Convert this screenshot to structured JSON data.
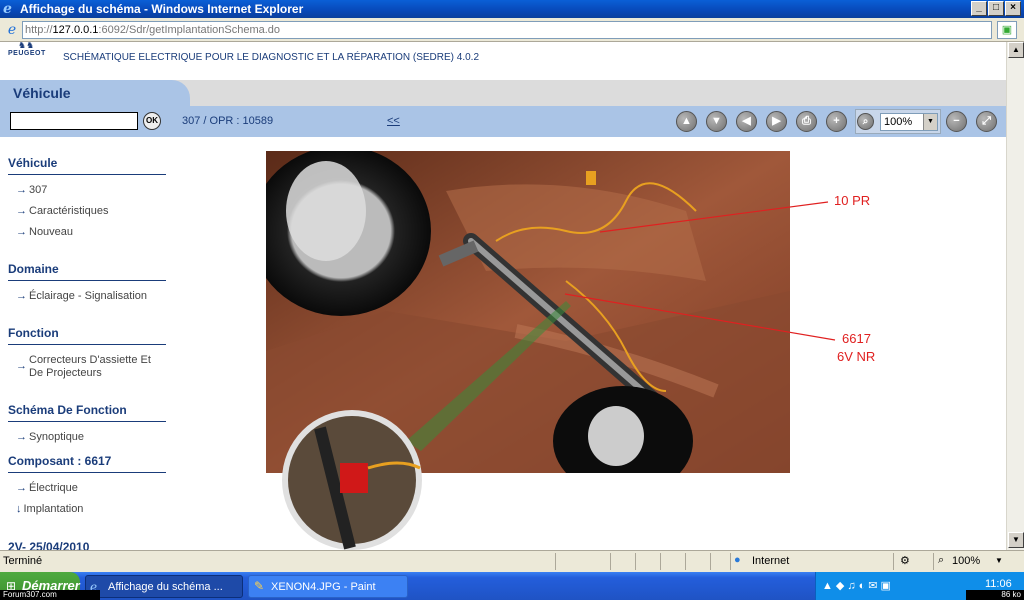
{
  "window": {
    "title": "Affichage du schéma - Windows Internet Explorer",
    "buttons": [
      "_",
      "□",
      "×"
    ]
  },
  "address": {
    "scheme": "http://",
    "host": "127.0.0.1",
    "path": ":6092/Sdr/getImplantationSchema.do"
  },
  "app": {
    "brand": "PEUGEOT",
    "title": "SCHÉMATIQUE ELECTRIQUE POUR LE DIAGNOSTIC ET LA RÉPARATION (SEDRE) 4.0.2"
  },
  "tabs": {
    "active": "Véhicule"
  },
  "toolbar": {
    "search_value": "",
    "ok_label": "OK",
    "vehicle_ref": "307  /  OPR : 10589",
    "back_label": "<<",
    "zoom_value": "100%"
  },
  "sidebar": {
    "vehicule": {
      "heading": "Véhicule",
      "items": [
        "307",
        "Caractéristiques",
        "Nouveau"
      ]
    },
    "domaine": {
      "heading": "Domaine",
      "items": [
        "Éclairage - Signalisation"
      ]
    },
    "fonction": {
      "heading": "Fonction",
      "items": [
        "Correcteurs D'assiette Et De Projecteurs"
      ]
    },
    "schema": {
      "heading": "Schéma De Fonction",
      "items": [
        "Synoptique"
      ]
    },
    "composant": {
      "heading": "Composant : 6617",
      "items": [
        "Électrique",
        "Implantation"
      ]
    },
    "footer": "2V- 25/04/2010"
  },
  "diagram": {
    "callouts": [
      "10 PR",
      "6617",
      "6V NR"
    ],
    "colors": {
      "underbody": "#7a3a24",
      "wire": "#e8a020",
      "callout": "#e02020"
    }
  },
  "statusbar": {
    "text": "Terminé",
    "zone": "Internet",
    "zoom": "100%"
  },
  "taskbar": {
    "start": "Démarrer",
    "forum_tag": "Forum307.com",
    "items": [
      "Affichage du schéma ...",
      "XENON4.JPG - Paint"
    ],
    "clock": "11:06",
    "kb_tag": "86 ko"
  }
}
